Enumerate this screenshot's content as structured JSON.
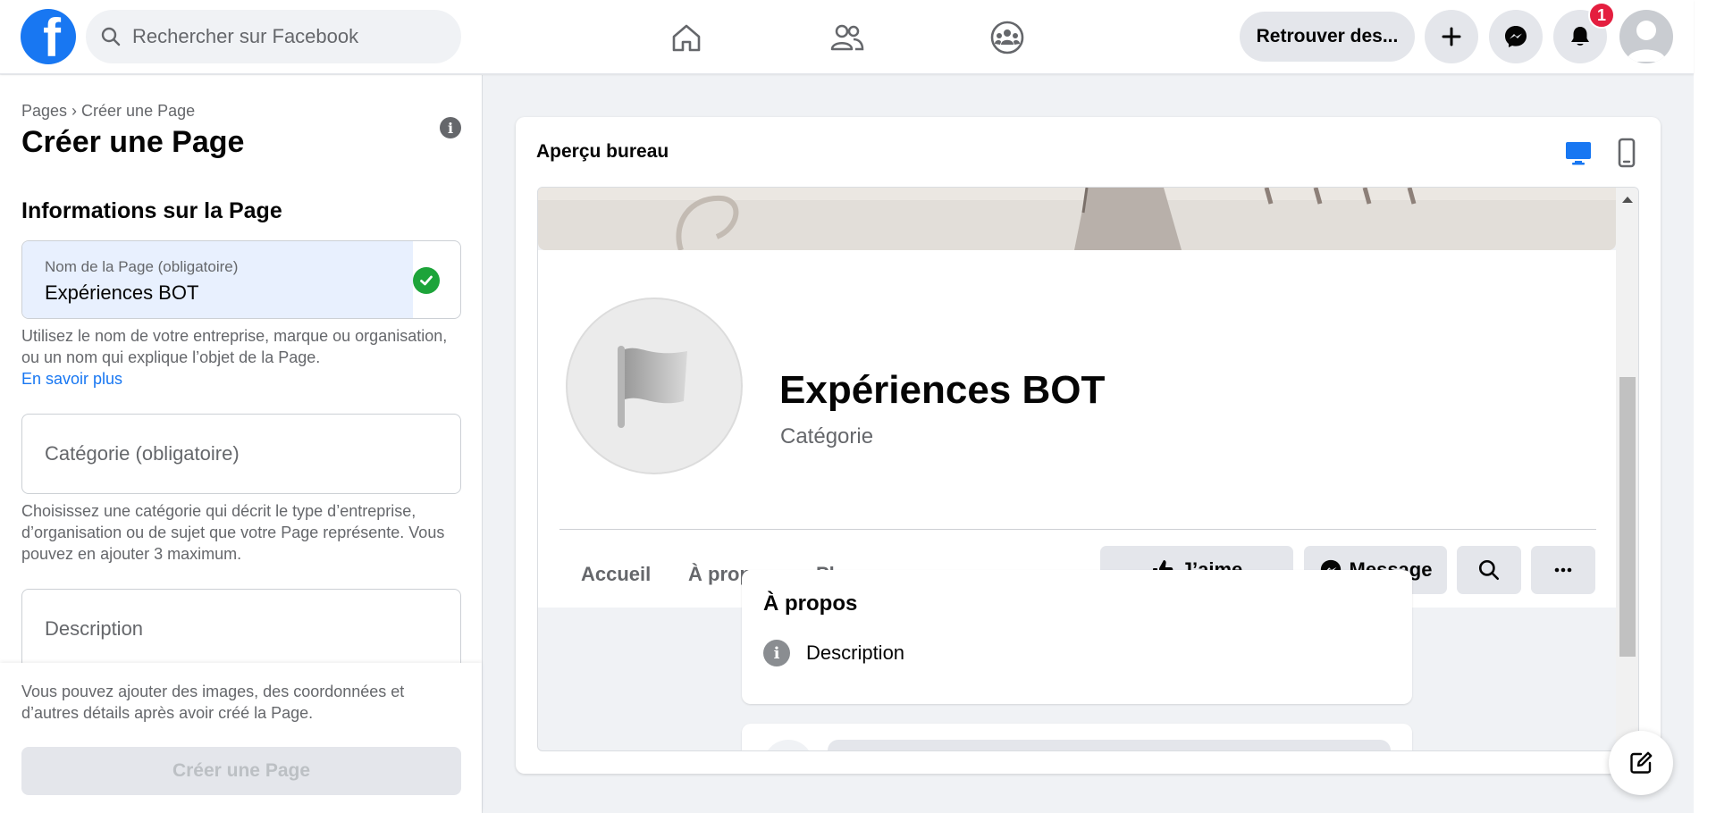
{
  "topbar": {
    "logo_letter": "f",
    "search_placeholder": "Rechercher sur Facebook",
    "nav_icons": [
      "home-icon",
      "friends-icon",
      "groups-icon"
    ],
    "find_friends_label": "Retrouver des...",
    "notification_count": "1"
  },
  "left": {
    "breadcrumb": "Pages › Créer une Page",
    "title": "Créer une Page",
    "section_title": "Informations sur la Page",
    "name_field": {
      "label": "Nom de la Page (obligatoire)",
      "value": "Expériences BOT"
    },
    "name_hint": "Utilisez le nom de votre entreprise, marque ou organisation, ou un nom qui explique l’objet de la Page.",
    "learn_more": "En savoir plus",
    "category_placeholder": "Catégorie (obligatoire)",
    "category_hint": "Choisissez une catégorie qui décrit le type d’entreprise, d’organisation ou de sujet que votre Page représente. Vous pouvez en ajouter 3 maximum.",
    "description_placeholder": "Description",
    "footer_hint": "Vous pouvez ajouter des images, des coordonnées et d’autres détails après avoir créé la Page.",
    "create_button": "Créer une Page"
  },
  "preview": {
    "title": "Aperçu bureau",
    "page_name": "Expériences BOT",
    "category": "Catégorie",
    "tabs": [
      "Accueil",
      "À propos",
      "Plus"
    ],
    "like_button": "J’aime",
    "message_button": "Message",
    "about_title": "À propos",
    "about_description": "Description"
  },
  "colors": {
    "brand": "#1877f2",
    "success": "#1da43a",
    "badge": "#e41e3f"
  }
}
